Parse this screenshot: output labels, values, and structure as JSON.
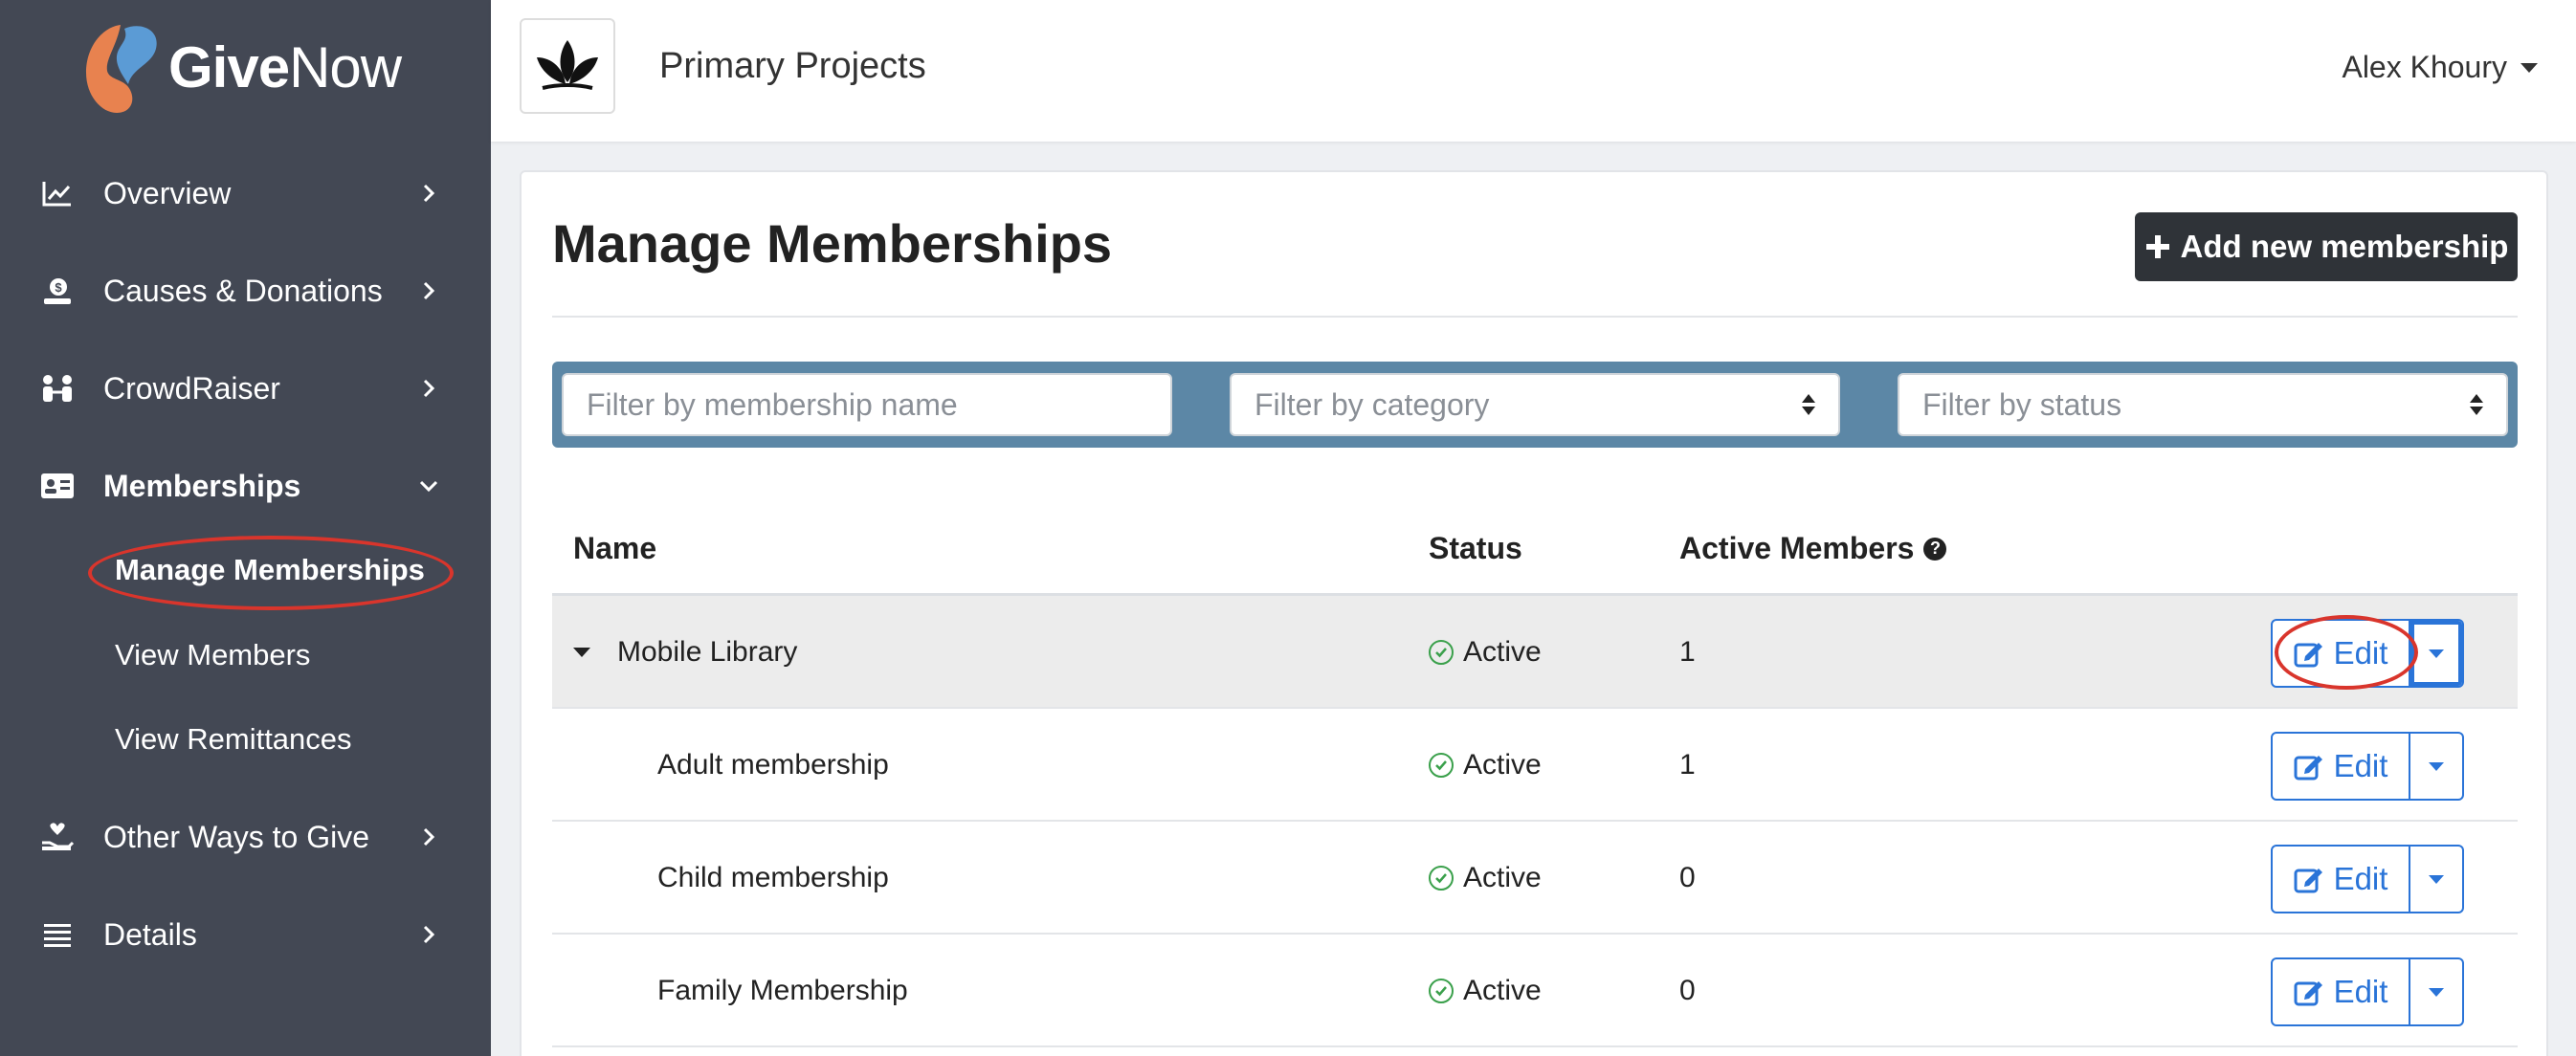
{
  "brand": {
    "name_bold": "Give",
    "name_regular": "Now"
  },
  "sidebar": {
    "items": [
      {
        "label": "Overview",
        "icon": "chart-line-icon"
      },
      {
        "label": "Causes & Donations",
        "icon": "donation-icon"
      },
      {
        "label": "CrowdRaiser",
        "icon": "people-icon"
      },
      {
        "label": "Memberships",
        "icon": "id-card-icon"
      },
      {
        "label": "Other Ways to Give",
        "icon": "hand-heart-icon"
      },
      {
        "label": "Details",
        "icon": "list-icon"
      }
    ],
    "sub_items": [
      {
        "label": "Manage Memberships"
      },
      {
        "label": "View Members"
      },
      {
        "label": "View Remittances"
      }
    ]
  },
  "header": {
    "org_title": "Primary Projects",
    "user_name": "Alex Khoury"
  },
  "main": {
    "title": "Manage Memberships",
    "add_button": "Add new membership",
    "filters": {
      "name_placeholder": "Filter by membership name",
      "category_placeholder": "Filter by category",
      "status_placeholder": "Filter by status"
    },
    "table": {
      "headers": {
        "name": "Name",
        "status": "Status",
        "active_members": "Active Members"
      },
      "edit_label": "Edit",
      "rows": [
        {
          "name": "Mobile Library",
          "status": "Active",
          "active_members": "1"
        },
        {
          "name": "Adult membership",
          "status": "Active",
          "active_members": "1"
        },
        {
          "name": "Child membership",
          "status": "Active",
          "active_members": "0"
        },
        {
          "name": "Family Membership",
          "status": "Active",
          "active_members": "0"
        }
      ]
    }
  },
  "colors": {
    "sidebar_bg": "#434854",
    "filter_bar": "#5c87a6",
    "primary_blue": "#2a74d8",
    "active_green": "#3aa04b",
    "annotation_red": "#d9352c",
    "logo_orange": "#e8824f",
    "logo_blue": "#5b9bd5"
  }
}
